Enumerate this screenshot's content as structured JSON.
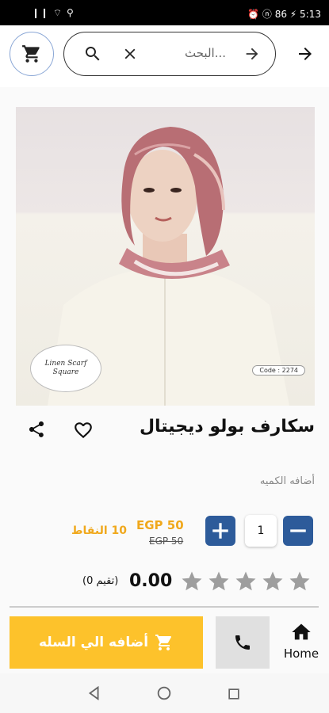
{
  "status_bar": {
    "left": "❙❙ ⌔ ⚲",
    "right": "⏰ ⓝ 86 ⚡ 5:13"
  },
  "search": {
    "placeholder": "البحث..."
  },
  "product": {
    "image_badge": "Linen Scarf Square",
    "image_code": "Code : 2274",
    "title": "سكارف بولو ديجيتال",
    "qty_label": "أضافه الكميه",
    "quantity": "1",
    "price": "EGP 50",
    "old_price": "EGP 50",
    "points": "10 النقاط",
    "rating": "0.00",
    "rating_count": "(تقيم 0)",
    "stars_filled": 0,
    "stars_total": 5
  },
  "bottom": {
    "add_to_cart": "أضافه الي السله",
    "home": "Home"
  },
  "colors": {
    "accent_blue": "#2d5b9a",
    "accent_yellow": "#fdc22b",
    "price_orange": "#f0a81c"
  },
  "icons": [
    "cart-icon",
    "search-icon",
    "close-icon",
    "arrow-right-icon",
    "back-arrow-icon",
    "heart-icon",
    "share-icon",
    "minus-icon",
    "plus-icon",
    "star-icon",
    "phone-icon",
    "home-icon"
  ]
}
